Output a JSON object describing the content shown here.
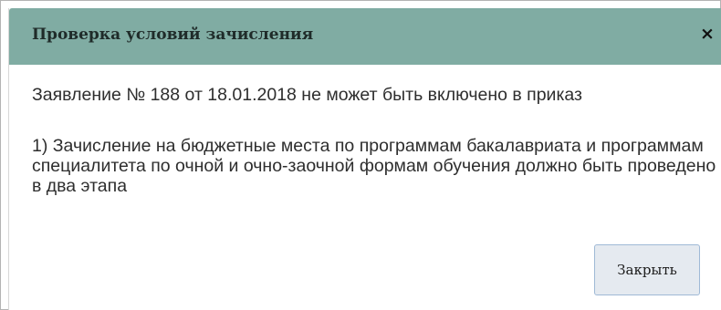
{
  "dialog": {
    "title": "Проверка условий зачисления",
    "close_icon": "×",
    "statement": "Заявление № 188 от 18.01.2018 не может быть включено в приказ",
    "condition": "1) Зачисление на бюджетные места по программам бакалавриата и программам специалитета по очной и очно-заочной формам обучения должно быть проведено в два этапа",
    "close_button_label": "Закрыть"
  },
  "colors": {
    "titlebar": "#80aca3",
    "button_bg": "#e5eaf0",
    "button_border": "#9fb9d6"
  }
}
